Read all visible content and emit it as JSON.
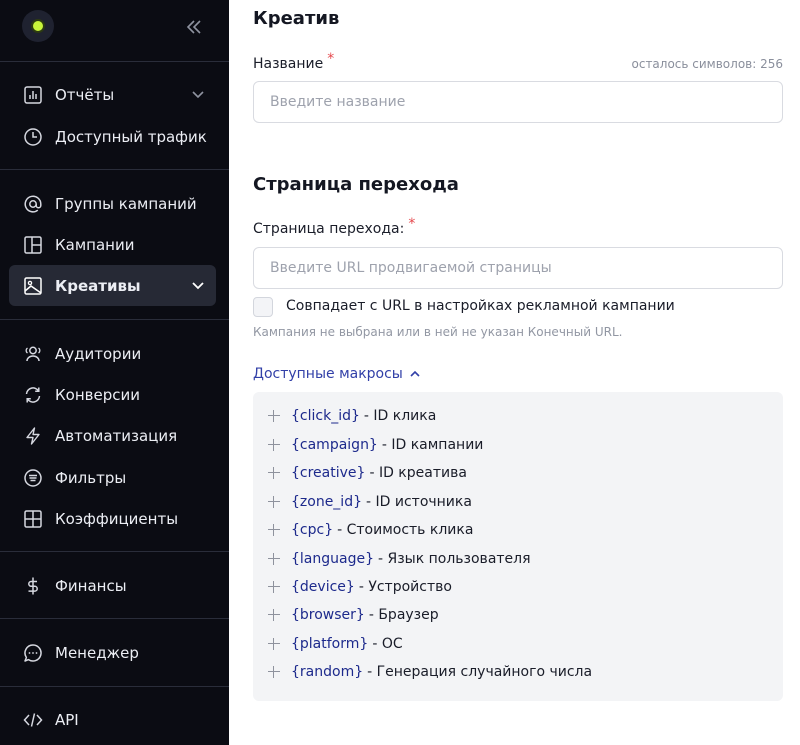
{
  "sidebar": {
    "logo": "app-logo",
    "collapse_icon": "double-chevron-left-icon",
    "items": [
      {
        "label": "Отчёты",
        "icon": "bar-chart-icon",
        "has_chevron": true
      },
      {
        "label": "Доступный трафик",
        "icon": "clock-icon"
      },
      {
        "label": "Группы кампаний",
        "icon": "at-sign-icon"
      },
      {
        "label": "Кампании",
        "icon": "layout-icon"
      },
      {
        "label": "Креативы",
        "icon": "image-icon",
        "active": true,
        "has_chevron": true
      },
      {
        "label": "Аудитории",
        "icon": "users-icon"
      },
      {
        "label": "Конверсии",
        "icon": "refresh-icon"
      },
      {
        "label": "Автоматизация",
        "icon": "lightning-icon"
      },
      {
        "label": "Фильтры",
        "icon": "filter-list-icon"
      },
      {
        "label": "Коэффициенты",
        "icon": "grid-icon"
      },
      {
        "label": "Финансы",
        "icon": "dollar-icon"
      },
      {
        "label": "Менеджер",
        "icon": "chat-icon"
      },
      {
        "label": "API",
        "icon": "code-icon"
      }
    ]
  },
  "main": {
    "creative_section_title": "Креатив",
    "name_label": "Название",
    "required_mark": "*",
    "chars_left": "осталось символов: 256",
    "name_placeholder": "Введите название",
    "landing_section_title": "Страница перехода",
    "landing_label": "Страница перехода:",
    "landing_placeholder": "Введите URL продвигаемой страницы",
    "match_checkbox_label": "Совпадает с URL в настройках рекламной кампании",
    "match_checkbox_checked": false,
    "hint": "Кампания не выбрана или в ней не указан Конечный URL.",
    "macros_toggle": "Доступные макросы",
    "macros": [
      {
        "code": "{click_id}",
        "desc": "- ID клика"
      },
      {
        "code": "{campaign}",
        "desc": "- ID кампании"
      },
      {
        "code": "{creative}",
        "desc": "- ID креатива"
      },
      {
        "code": "{zone_id}",
        "desc": "- ID источника"
      },
      {
        "code": "{cpc}",
        "desc": "- Стоимость клика"
      },
      {
        "code": "{language}",
        "desc": "- Язык пользователя"
      },
      {
        "code": "{device}",
        "desc": "- Устройство"
      },
      {
        "code": "{browser}",
        "desc": "- Браузер"
      },
      {
        "code": "{platform}",
        "desc": "- ОС"
      },
      {
        "code": "{random}",
        "desc": "- Генерация случайного числа"
      }
    ]
  },
  "colors": {
    "sidebar_bg": "#0b0c13",
    "active_item_bg": "#262935",
    "accent_link": "#3240a8",
    "required": "#e5484d",
    "logo_dot": "#c8f53a"
  }
}
